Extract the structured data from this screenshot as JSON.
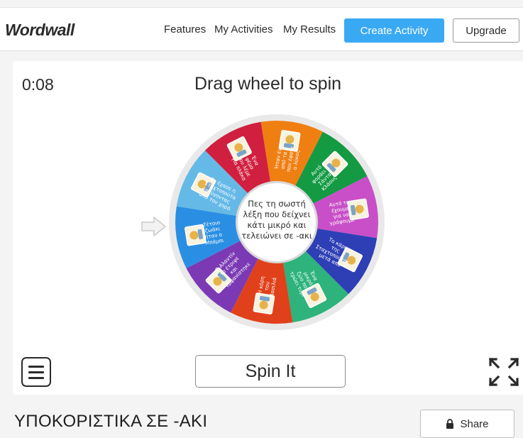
{
  "header": {
    "logo": "Wordwall",
    "nav": [
      "Features",
      "My Activities",
      "My Results"
    ],
    "create_label": "Create Activity",
    "upgrade_label": "Upgrade",
    "accent_color": "#39a9f4"
  },
  "activity": {
    "timer": "0:08",
    "instruction": "Drag wheel to spin",
    "center_text": [
      "Πες τη σωστή",
      "λέξη που δείχνει",
      "κάτι μικρό και",
      "τελειώνει σε -ακι"
    ],
    "segments": [
      {
        "color": "#f07f12",
        "lines": [
          "Ήταν ένα",
          "από τα 7",
          "που έφαγε",
          "ο λύκος"
        ],
        "icon": "goat-picture"
      },
      {
        "color": "#139a43",
        "lines": [
          "Αυτό",
          "φοράει ο",
          "Σάντα",
          "Κλάους"
        ],
        "icon": "santa-picture"
      },
      {
        "color": "#c84fc7",
        "lines": [
          "Αυτό το",
          "έχουμε",
          "για να",
          "γράφουμε"
        ],
        "icon": "pencil-picture"
      },
      {
        "color": "#2e3fb5",
        "lines": [
          "Το κάρο",
          "της",
          "Σταχτοπούτας",
          "μετά από"
        ],
        "icon": "carriage-picture"
      },
      {
        "color": "#2db37b",
        "lines": [
          "Ένα",
          "μικρό",
          "ζώο που",
          "τρώει τυρί"
        ],
        "icon": "mouse-picture"
      },
      {
        "color": "#e0411a",
        "lines": [
          "Η κόρη",
          "του",
          "βασιλιά"
        ],
        "icon": "princess-picture"
      },
      {
        "color": "#7b3ab4",
        "lines": [
          "Ο Αλαντίν",
          "το έτριψε",
          "και",
          "εμφανίστηκε"
        ],
        "icon": "lamp-picture"
      },
      {
        "color": "#2a8fe3",
        "lines": [
          "Τέτοιο",
          "ζωάκι",
          "ήταν ο",
          "Μπάμπι"
        ],
        "icon": "deer-picture"
      },
      {
        "color": "#65b9e6",
        "lines": [
          "Το έχασε η",
          "Σταχτοπούτα",
          "φεύγοντας",
          "από τον χορό"
        ],
        "icon": "shoe-picture"
      },
      {
        "color": "#d11f3f",
        "lines": [
          "Ένα",
          "ψέμα",
          "που λέμε",
          "για πλάκα"
        ],
        "icon": "cake-picture"
      }
    ],
    "spin_label": "Spin It"
  },
  "footer": {
    "title": "ΥΠΟΚΟΡΙΣΤΙΚΑ ΣΕ -ΑΚΙ",
    "share_label": "Share"
  }
}
